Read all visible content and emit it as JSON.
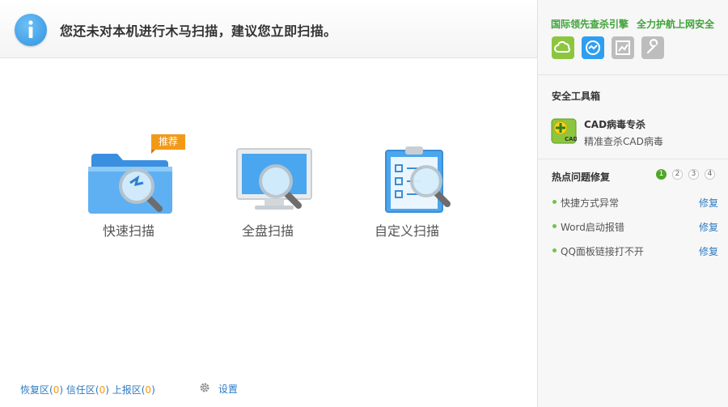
{
  "header": {
    "message": "您还未对本机进行木马扫描，建议您立即扫描。",
    "icon": "info-icon"
  },
  "scan_options": {
    "quick": {
      "label": "快速扫描",
      "badge": "推荐",
      "icon": "folder-magnifier-icon"
    },
    "full": {
      "label": "全盘扫描",
      "icon": "monitor-magnifier-icon"
    },
    "custom": {
      "label": "自定义扫描",
      "icon": "clipboard-magnifier-icon"
    }
  },
  "footer": {
    "recovery_label": "恢复区",
    "recovery_count": "0",
    "trust_label": "信任区",
    "trust_count": "0",
    "report_label": "上报区",
    "report_count": "0",
    "settings_label": "设置",
    "settings_icon": "gear-icon"
  },
  "sidebar": {
    "slogan_1": "国际领先查杀引擎",
    "slogan_2": "全力护航上网安全",
    "engine_icons": [
      "cloud-engine-icon",
      "heuristic-engine-icon",
      "chart-engine-icon",
      "repair-engine-icon"
    ],
    "toolbox_title": "安全工具箱",
    "tool": {
      "name": "CAD病毒专杀",
      "desc": "精准查杀CAD病毒",
      "icon": "cad-tool-icon"
    },
    "hot_title": "热点问题修复",
    "pages": [
      "1",
      "2",
      "3",
      "4"
    ],
    "active_page": "1",
    "fixes": [
      {
        "text": "快捷方式异常",
        "action": "修复"
      },
      {
        "text": "Word启动报错",
        "action": "修复"
      },
      {
        "text": "QQ面板链接打不开",
        "action": "修复"
      }
    ]
  },
  "colors": {
    "accent_blue": "#2c7bc5",
    "accent_green": "#3fa33a",
    "badge_orange": "#f29a17"
  }
}
